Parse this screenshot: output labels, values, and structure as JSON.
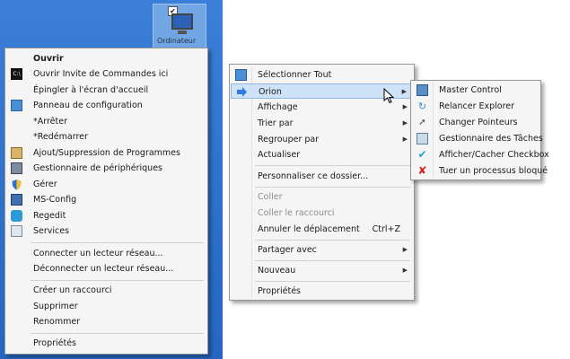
{
  "desktop": {
    "icon_label": "Ordinateur",
    "check": "✔"
  },
  "left_menu": {
    "items": [
      {
        "label": "Ouvrir",
        "icon": ""
      },
      {
        "label": "Ouvrir Invite de Commandes ici",
        "icon": "cmd-icon"
      },
      {
        "label": "Épingler à l'écran d'accueil",
        "icon": ""
      },
      {
        "label": "Panneau de configuration",
        "icon": "control-panel-icon"
      },
      {
        "label": "*Arrêter",
        "icon": ""
      },
      {
        "label": "*Redémarrer",
        "icon": ""
      },
      {
        "label": "Ajout/Suppression de Programmes",
        "icon": "programs-icon"
      },
      {
        "label": "Gestionnaire de périphériques",
        "icon": "device-manager-icon"
      },
      {
        "label": "Gérer",
        "icon": "shield-icon"
      },
      {
        "label": "MS-Config",
        "icon": "msconfig-icon"
      },
      {
        "label": "Regedit",
        "icon": "regedit-icon"
      },
      {
        "label": "Services",
        "icon": "services-icon"
      },
      {
        "label": "Connecter un lecteur réseau...",
        "icon": ""
      },
      {
        "label": "Déconnecter un lecteur réseau...",
        "icon": ""
      },
      {
        "label": "Créer un raccourci",
        "icon": ""
      },
      {
        "label": "Supprimer",
        "icon": ""
      },
      {
        "label": "Renommer",
        "icon": ""
      },
      {
        "label": "Propriétés",
        "icon": ""
      }
    ]
  },
  "mid_menu": {
    "items": [
      {
        "label": "Sélectionner Tout",
        "icon": "select-all-icon"
      },
      {
        "label": "Orion",
        "icon": "arrow-right-icon"
      },
      {
        "label": "Affichage"
      },
      {
        "label": "Trier par"
      },
      {
        "label": "Regrouper par"
      },
      {
        "label": "Actualiser"
      },
      {
        "label": "Personnaliser ce dossier..."
      },
      {
        "label": "Coller"
      },
      {
        "label": "Coller le raccourci"
      },
      {
        "label": "Annuler le déplacement",
        "shortcut": "Ctrl+Z"
      },
      {
        "label": "Partager avec"
      },
      {
        "label": "Nouveau"
      },
      {
        "label": "Propriétés"
      }
    ]
  },
  "sub_menu": {
    "items": [
      {
        "label": "Master Control",
        "icon": "master-control-icon"
      },
      {
        "label": "Relancer Explorer",
        "icon": "refresh-icon"
      },
      {
        "label": "Changer Pointeurs",
        "icon": "pointer-icon"
      },
      {
        "label": "Gestionnaire des Tâches",
        "icon": "task-manager-icon"
      },
      {
        "label": "Afficher/Cacher Checkbox",
        "icon": "checkmark-icon"
      },
      {
        "label": "Tuer un processus bloqué",
        "icon": "kill-icon"
      }
    ]
  },
  "symbols": {
    "submenu_arrow": "▶"
  }
}
